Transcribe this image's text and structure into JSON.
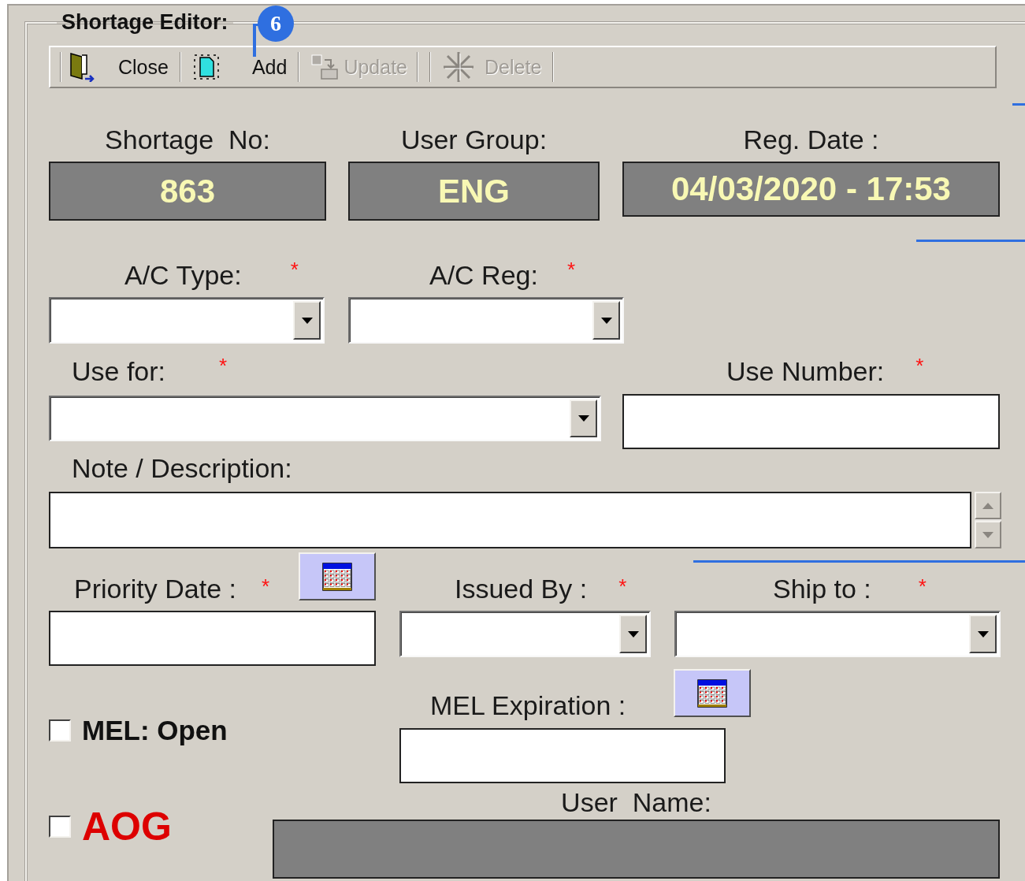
{
  "form": {
    "title": "Shortage Editor:"
  },
  "callout": {
    "number": "6"
  },
  "toolbar": [
    {
      "kind": "close",
      "label": "Close",
      "disabled": false
    },
    {
      "kind": "add",
      "label": "Add",
      "disabled": false
    },
    {
      "kind": "update",
      "label": "Update",
      "disabled": true
    },
    {
      "kind": "delete",
      "label": "Delete",
      "disabled": true
    }
  ],
  "info": [
    {
      "label": "Shortage  No:",
      "value": "863"
    },
    {
      "label": "User Group:",
      "value": "ENG"
    },
    {
      "label": "Reg. Date :",
      "value": "04/03/2020 - 17:53"
    }
  ],
  "ac_type": {
    "kind": "combo",
    "label": "A/C Type:",
    "marker": "*"
  },
  "ac_reg": {
    "kind": "combo",
    "label": "A/C Reg:",
    "marker": "*"
  },
  "use_for": {
    "kind": "combo",
    "label": "Use for:",
    "marker": "*"
  },
  "use_number": {
    "kind": "text",
    "label": "Use Number:",
    "marker": "*"
  },
  "note": {
    "kind": "memo",
    "label": "Note / Description:"
  },
  "priority_date": {
    "kind": "date",
    "label": "Priority Date :",
    "marker": "*"
  },
  "issued_by": {
    "kind": "combo",
    "label": "Issued By :",
    "marker": "*"
  },
  "ship_to": {
    "kind": "combo",
    "label": "Ship to :",
    "marker": "*"
  },
  "mel_open": {
    "label": "MEL: Open",
    "checked": false
  },
  "mel_expiration": {
    "kind": "date",
    "label": "MEL Expiration :"
  },
  "aog": {
    "label": "AOG",
    "checked": false
  },
  "user_name": {
    "kind": "display",
    "label": "User  Name:"
  }
}
